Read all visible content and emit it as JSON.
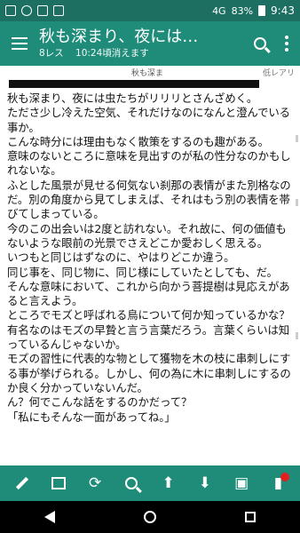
{
  "status": {
    "signal": "4G",
    "battery": "83%",
    "time": "9:43"
  },
  "header": {
    "title": "秋も深まり、夜には…",
    "replies": "8レス",
    "expiry": "10:24頃消えます"
  },
  "post": {
    "name": "秋も深ま",
    "rarity": "低レアリ",
    "lines": [
      "秋も深まり、夜には虫たちがリリリとさんざめく。",
      "たださ少し冷えた空気、それだけなのになんと澄んでいる事か。",
      "こんな時分には理由もなく散策をするのも趣がある。",
      "意味のないところに意味を見出すのが私の性分なのかもしれないな。",
      "ふとした風景が見せる何気ない刹那の表情がまた別格なのだ。別の角度から見てしまえば、それはもう別の表情を帯びてしまっている。",
      "今のこの出会いは2度と訪れない。それ故に、何の価値もないような眼前の光景でさえどこか愛おしく思える。",
      "いつもと同じはずなのに、やはりどこか違う。",
      "同じ事を、同じ物に、同じ様にしていたとしても、だ。",
      "そんな意味において、これから向かう菩提樹は見応えがあると言えよう。",
      "ところでモズと呼ばれる鳥について何か知っているかな？",
      "有名なのはモズの早贄と言う言葉だろう。言葉くらいは知っているんじゃないか。",
      "モズの習性に代表的な物として獲物を木の枝に串刺しにする事が挙げられる。しかし、何の為に木に串刺しにするのか良く分かっていないんだ。",
      "ん？何でこんな話をするのかだって？",
      "「私にもそんな一面があってね。」"
    ]
  },
  "toolbar": {
    "icons": [
      "pencil-icon",
      "stats-icon",
      "refresh-icon",
      "search-icon",
      "arrow-up-icon",
      "arrow-down-icon",
      "image-icon",
      "bookmark-icon"
    ]
  },
  "colors": {
    "primary": "#1f8c7a",
    "status": "#1d6f62",
    "badge": "#e02020"
  }
}
